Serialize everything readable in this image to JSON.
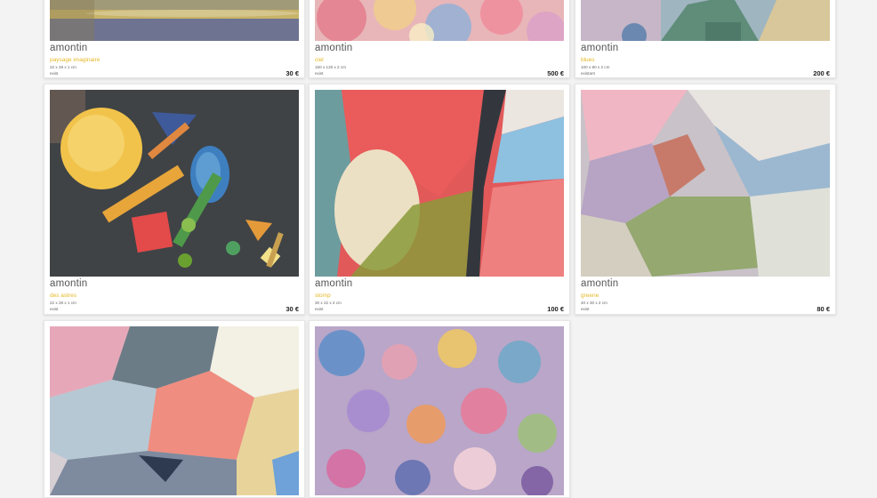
{
  "cards": [
    {
      "artist": "amontin",
      "title": "paysage imaginaire",
      "dimensions": "22 x 28 x 1 cm",
      "status": "exist",
      "price": "30 €"
    },
    {
      "artist": "amontin",
      "title": "ciel",
      "dimensions": "150 x 125 x 2 cm",
      "status": "exist",
      "price": "500 €"
    },
    {
      "artist": "amontin",
      "title": "blues",
      "dimensions": "100 x 80 x 2 cm",
      "status": "existant",
      "price": "200 €"
    },
    {
      "artist": "amontin",
      "title": "des astres",
      "dimensions": "22 x 28 x 1 cm",
      "status": "exist",
      "price": "30 €"
    },
    {
      "artist": "amontin",
      "title": "stomp",
      "dimensions": "30 x 22 x 2 cm",
      "status": "exist",
      "price": "100 €"
    },
    {
      "artist": "amontin",
      "title": "greene",
      "dimensions": "40 x 30 x 2 cm",
      "status": "exist",
      "price": "80 €"
    },
    {
      "artist": "",
      "title": "",
      "dimensions": "",
      "status": "",
      "price": ""
    },
    {
      "artist": "",
      "title": "",
      "dimensions": "",
      "status": "",
      "price": ""
    }
  ]
}
